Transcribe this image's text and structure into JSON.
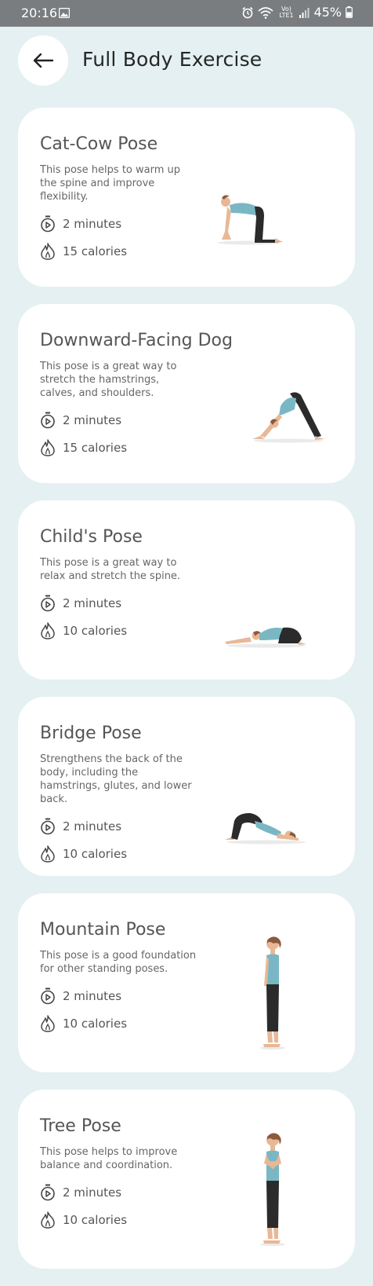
{
  "status_bar": {
    "time": "20:16",
    "battery": "45%",
    "network": "Vo) LTE1"
  },
  "header": {
    "title": "Full Body Exercise"
  },
  "colors": {
    "background": "#e4f0f1",
    "card": "#ffffff",
    "skin": "#e8b896",
    "top": "#7ab7c4",
    "pants": "#2b2b2b",
    "hair": "#8b5a3c"
  },
  "exercises": [
    {
      "title": "Cat-Cow Pose",
      "description": "This pose helps to warm up the spine and improve flexibility.",
      "duration": "2 minutes",
      "calories": "15 calories",
      "pose": "cat-cow"
    },
    {
      "title": "Downward-Facing Dog",
      "description": "This pose is a great way to stretch the hamstrings, calves, and shoulders.",
      "duration": "2 minutes",
      "calories": "15 calories",
      "pose": "downward-dog"
    },
    {
      "title": "Child's Pose",
      "description": "This pose is a great way to relax and stretch the spine.",
      "duration": "2 minutes",
      "calories": "10 calories",
      "pose": "child"
    },
    {
      "title": "Bridge Pose",
      "description": "Strengthens the back of the body, including the hamstrings, glutes, and lower back.",
      "duration": "2 minutes",
      "calories": "10 calories",
      "pose": "bridge"
    },
    {
      "title": "Mountain Pose",
      "description": "This pose is a good foundation for other standing poses.",
      "duration": "2 minutes",
      "calories": "10 calories",
      "pose": "mountain"
    },
    {
      "title": "Tree Pose",
      "description": "This pose helps to improve balance and coordination.",
      "duration": "2 minutes",
      "calories": "10 calories",
      "pose": "tree"
    }
  ]
}
